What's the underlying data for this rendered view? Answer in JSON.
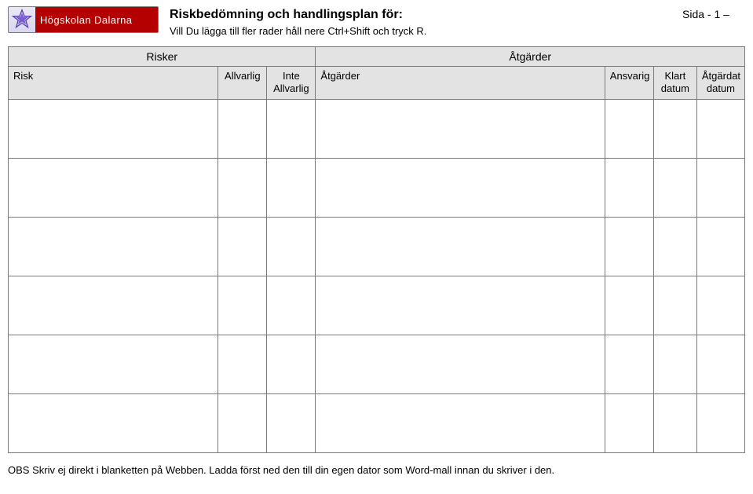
{
  "logo": {
    "text": "Högskolan Dalarna"
  },
  "header": {
    "title": "Riskbedömning och handlingsplan för:",
    "page_label": "Sida - 1 –",
    "instruction": "Vill Du lägga till fler rader håll nere Ctrl+Shift och tryck R."
  },
  "group_headers": {
    "risker": "Risker",
    "atgarder": "Åtgärder"
  },
  "columns": {
    "risk": "Risk",
    "allvarlig": "Allvarlig",
    "inte_allvarlig_line1": "Inte",
    "inte_allvarlig_line2": "Allvarlig",
    "atgarder": "Åtgärder",
    "ansvarig": "Ansvarig",
    "klart_line1": "Klart",
    "klart_line2": "datum",
    "atgardat_line1": "Åtgärdat",
    "atgardat_line2": "datum"
  },
  "rows": [
    {
      "risk": "",
      "allvarlig": "",
      "inte_allvarlig": "",
      "atgarder": "",
      "ansvarig": "",
      "klart": "",
      "atgardat": ""
    },
    {
      "risk": "",
      "allvarlig": "",
      "inte_allvarlig": "",
      "atgarder": "",
      "ansvarig": "",
      "klart": "",
      "atgardat": ""
    },
    {
      "risk": "",
      "allvarlig": "",
      "inte_allvarlig": "",
      "atgarder": "",
      "ansvarig": "",
      "klart": "",
      "atgardat": ""
    },
    {
      "risk": "",
      "allvarlig": "",
      "inte_allvarlig": "",
      "atgarder": "",
      "ansvarig": "",
      "klart": "",
      "atgardat": ""
    },
    {
      "risk": "",
      "allvarlig": "",
      "inte_allvarlig": "",
      "atgarder": "",
      "ansvarig": "",
      "klart": "",
      "atgardat": ""
    },
    {
      "risk": "",
      "allvarlig": "",
      "inte_allvarlig": "",
      "atgarder": "",
      "ansvarig": "",
      "klart": "",
      "atgardat": ""
    }
  ],
  "footer": {
    "text": "OBS Skriv ej direkt i blanketten på Webben. Ladda först ned den till din egen dator som Word-mall innan du skriver i den."
  }
}
